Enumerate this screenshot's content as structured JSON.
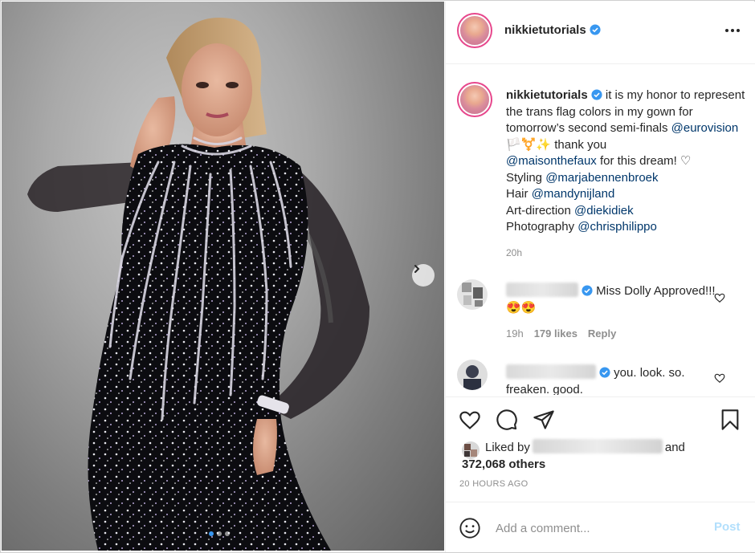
{
  "header": {
    "username": "nikkietutorials",
    "verified_icon": "verified-badge-icon",
    "more_icon": "more-options-icon"
  },
  "caption": {
    "username": "nikkietutorials",
    "text_1": "it is my honor to represent the trans flag colors in my gown for tomorrow’s second semi-finals",
    "mention_eurovision": "@eurovision",
    "emojis_1": "🏳️⚧️✨",
    "text_2": "thank you",
    "mention_maison": "@maisonthefaux",
    "text_3": "for this dream! ♡",
    "styling_label": "Styling",
    "styling_mention": "@marjabennenbroek",
    "hair_label": "Hair",
    "hair_mention": "@mandynijland",
    "art_label": "Art-direction",
    "art_mention": "@diekidiek",
    "photo_label": "Photography",
    "photo_mention": "@chrisphilippo",
    "time": "20h"
  },
  "comments": [
    {
      "text": "Miss Dolly Approved!!!",
      "emojis": "😍😍",
      "time": "19h",
      "likes": "179 likes",
      "reply": "Reply"
    },
    {
      "text": "you. look. so. freaken. good."
    }
  ],
  "actions": {
    "like_icon": "heart-icon",
    "comment_icon": "comment-icon",
    "share_icon": "share-icon",
    "save_icon": "bookmark-icon",
    "liked_by_prefix": "Liked by",
    "liked_by_and": "and",
    "liked_others": "372,068 others",
    "posted_ago": "20 HOURS AGO"
  },
  "add_comment": {
    "placeholder": "Add a comment...",
    "post_label": "Post"
  },
  "carousel": {
    "slide_count": 3,
    "active_index": 0
  },
  "colors": {
    "link": "#00376b",
    "verified": "#3897f0",
    "muted": "#8e8e8e",
    "post_disabled": "#b2dffc"
  }
}
